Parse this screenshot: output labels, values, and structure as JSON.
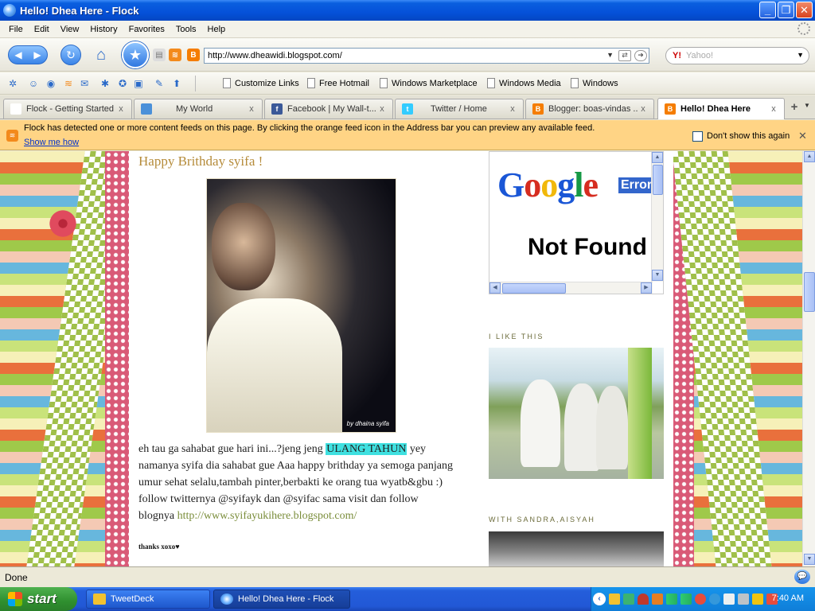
{
  "window": {
    "title": "Hello! Dhea Here - Flock",
    "minimize": "_",
    "maximize": "❐",
    "close": "✕"
  },
  "menu": [
    "File",
    "Edit",
    "View",
    "History",
    "Favorites",
    "Tools",
    "Help"
  ],
  "nav": {
    "url": "http://www.dheawidi.blogspot.com/",
    "search_placeholder": "Yahoo!",
    "search_logo": "Y!"
  },
  "bookmarks": [
    "Customize Links",
    "Free Hotmail",
    "Windows Marketplace",
    "Windows Media",
    "Windows"
  ],
  "tabs": [
    {
      "label": "Flock - Getting Started",
      "icon_color": "#ffffff",
      "active": false
    },
    {
      "label": "My World",
      "icon_color": "#4a90d9",
      "active": false
    },
    {
      "label": "Facebook | My Wall-t...",
      "icon_color": "#3b5998",
      "active": false
    },
    {
      "label": "Twitter / Home",
      "icon_color": "#33ccff",
      "active": false
    },
    {
      "label": "Blogger: boas-vindas ...",
      "icon_color": "#f57d00",
      "active": false
    },
    {
      "label": "Hello! Dhea Here",
      "icon_color": "#f57d00",
      "active": true
    }
  ],
  "tab_close": "x",
  "feedbar": {
    "message": "Flock has detected one or more content feeds on this page. By clicking the orange feed icon in the Address bar you can preview any available feed.",
    "link": "Show me how",
    "checkbox_label": "Don't show this again",
    "close": "✕"
  },
  "post": {
    "title": "Happy Brithday syifa !",
    "signature": "by dhaina syifa",
    "body_before": "eh tau ga sahabat gue hari ini...?jeng jeng ",
    "highlight": "ULANG TAHUN",
    "body_after": " yey namanya syifa dia sahabat gue Aaa happy brithday ya semoga panjang umur sehat selalu,tambah pinter,berbakti ke orang tua wyatb&gbu :) follow twitternya @syifayk dan @syifac sama visit dan follow blognya ",
    "link": "http://www.syifayukihere.blogspot.com/",
    "thanks": "thanks xoxo♥"
  },
  "sidebar": {
    "google_letters": [
      {
        "ch": "G",
        "color": "#1a56d6"
      },
      {
        "ch": "o",
        "color": "#d62d20"
      },
      {
        "ch": "o",
        "color": "#f1b80a"
      },
      {
        "ch": "g",
        "color": "#1a56d6"
      },
      {
        "ch": "l",
        "color": "#159945"
      },
      {
        "ch": "e",
        "color": "#d62d20"
      }
    ],
    "error": "Error",
    "not_found": "Not Found",
    "heading1": "I LIKE THIS",
    "heading2": "WITH SANDRA,AISYAH"
  },
  "status": {
    "text": "Done"
  },
  "taskbar": {
    "start": "start",
    "tasks": [
      "TweetDeck",
      "Hello! Dhea Here - Flock"
    ],
    "clock": "7:40 AM"
  }
}
